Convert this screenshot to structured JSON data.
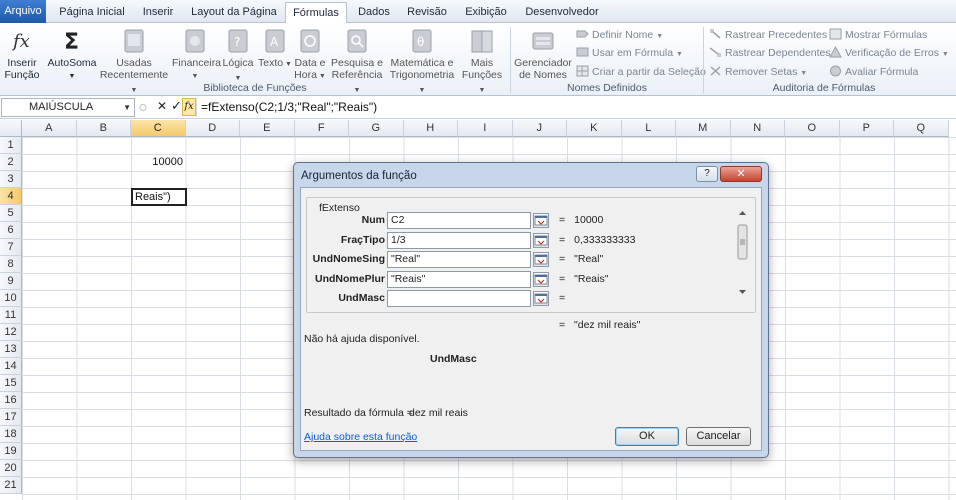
{
  "ribbon_tabs": [
    "Arquivo",
    "Página Inicial",
    "Inserir",
    "Layout da Página",
    "Fórmulas",
    "Dados",
    "Revisão",
    "Exibição",
    "Desenvolvedor"
  ],
  "active_tab": "Fórmulas",
  "ribbon": {
    "inserir_funcao": [
      "Inserir",
      "Função"
    ],
    "autosoma": "AutoSoma",
    "usadas": [
      "Usadas",
      "Recentemente"
    ],
    "financeira": "Financeira",
    "logica": "Lógica",
    "texto": "Texto",
    "data_hora": [
      "Data e",
      "Hora"
    ],
    "pesquisa": [
      "Pesquisa e",
      "Referência"
    ],
    "matematica": [
      "Matemática e",
      "Trigonometria"
    ],
    "mais_funcoes": [
      "Mais",
      "Funções"
    ],
    "gerenciador": [
      "Gerenciador",
      "de Nomes"
    ],
    "definir_nome": "Definir Nome",
    "usar_em_formula": "Usar em Fórmula",
    "criar_partir": "Criar a partir da Seleção",
    "rastrear_precedentes": "Rastrear Precedentes",
    "rastrear_dependentes": "Rastrear Dependentes",
    "remover_setas": "Remover Setas",
    "mostrar_formulas": "Mostrar Fórmulas",
    "verificacao_erros": "Verificação de Erros",
    "avaliar_formula": "Avaliar Fórmula",
    "groups": {
      "biblioteca": "Biblioteca de Funções",
      "nomes": "Nomes Definidos",
      "auditoria": "Auditoria de Fórmulas"
    }
  },
  "formula_bar": {
    "name_box": "MAIÚSCULA",
    "cancel_symbol": "✕",
    "enter_symbol": "✓",
    "fx_symbol": "fx",
    "formula": "=fExtenso(C2;1/3;\"Real\";\"Reais\")"
  },
  "columns": [
    "A",
    "B",
    "C",
    "D",
    "E",
    "F",
    "G",
    "H",
    "I",
    "J",
    "K",
    "L",
    "M",
    "N",
    "O",
    "P",
    "Q"
  ],
  "rows": [
    "1",
    "2",
    "3",
    "4",
    "5",
    "6",
    "7",
    "8",
    "9",
    "10",
    "11",
    "12",
    "13",
    "14",
    "15",
    "16",
    "17",
    "18",
    "19",
    "20",
    "21"
  ],
  "cells": {
    "C2": "10000",
    "C4": "Reais\")"
  },
  "dialog": {
    "title": "Argumentos da função",
    "help_symbol": "?",
    "close_symbol": "✕",
    "function_name": "fExtenso",
    "args": [
      {
        "label": "Num",
        "value": "C2",
        "result": "10000"
      },
      {
        "label": "FraçTipo",
        "value": "1/3",
        "result": "0,333333333"
      },
      {
        "label": "UndNomeSing",
        "value": "\"Real\"",
        "result": "\"Real\""
      },
      {
        "label": "UndNomePlur",
        "value": "\"Reais\"",
        "result": "\"Reais\""
      },
      {
        "label": "UndMasc",
        "value": "",
        "result": ""
      }
    ],
    "equals": "=",
    "overall_result": "\"dez mil reais\"",
    "no_help": "Não há ajuda disponível.",
    "current_arg": "UndMasc",
    "formula_result_label": "Resultado da fórmula =",
    "formula_result_value": "dez mil reais",
    "help_link": "Ajuda sobre esta função",
    "ok": "OK",
    "cancel": "Cancelar"
  },
  "colors": {
    "file_tab": "#2b6cc4",
    "selection_header": "#f5c96a",
    "link": "#0a5ed7",
    "dialog_frame": "#c7d6ea"
  }
}
